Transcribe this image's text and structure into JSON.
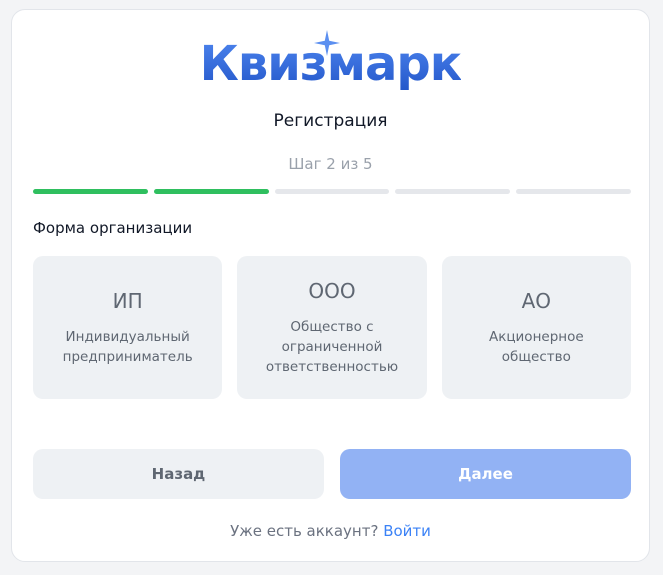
{
  "brand": {
    "logo_text": "Квизмарк",
    "logo_color": "#2f66d8",
    "sparkle_color": "#5b8ff0"
  },
  "header": {
    "title": "Регистрация",
    "step_text": "Шаг 2 из 5"
  },
  "progress": {
    "current_step": 2,
    "total_steps": 5,
    "active_color": "#2fbf5f",
    "inactive_color": "#e5e7eb"
  },
  "form": {
    "section_label": "Форма организации",
    "options": [
      {
        "code": "ИП",
        "description": "Индивидуальный\nпредприниматель"
      },
      {
        "code": "ООО",
        "description": "Общество с\nограниченной\nответственностью"
      },
      {
        "code": "АО",
        "description": "Акционерное\nобщество"
      }
    ]
  },
  "actions": {
    "back_label": "Назад",
    "next_label": "Далее",
    "next_color": "#92b2f4"
  },
  "footer": {
    "text": "Уже есть аккаунт?",
    "link_label": "Войти"
  }
}
